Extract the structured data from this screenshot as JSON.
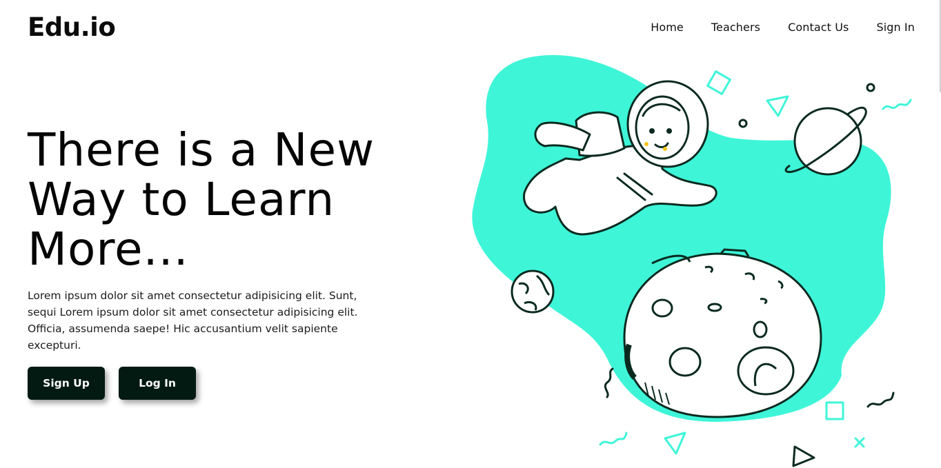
{
  "header": {
    "logo": "Edu.io",
    "nav": [
      {
        "label": "Home"
      },
      {
        "label": "Teachers"
      },
      {
        "label": "Contact Us"
      },
      {
        "label": "Sign In"
      }
    ]
  },
  "hero": {
    "title": "There is a New Way to Learn More...",
    "text": "Lorem ipsum dolor sit amet consectetur adipisicing elit. Sunt, sequi Lorem ipsum dolor sit amet consectetur adipisicing elit. Officia, assumenda saepe! Hic accusantium velit sapiente excepturi.",
    "signup_label": "Sign Up",
    "login_label": "Log In"
  },
  "colors": {
    "accent": "#3ef5d8",
    "button_bg": "#031a12",
    "text": "#0b0b0b"
  },
  "illustration": {
    "icons": [
      "astronaut-icon",
      "ringed-planet-icon",
      "moon-icon",
      "small-planet-icon"
    ]
  }
}
